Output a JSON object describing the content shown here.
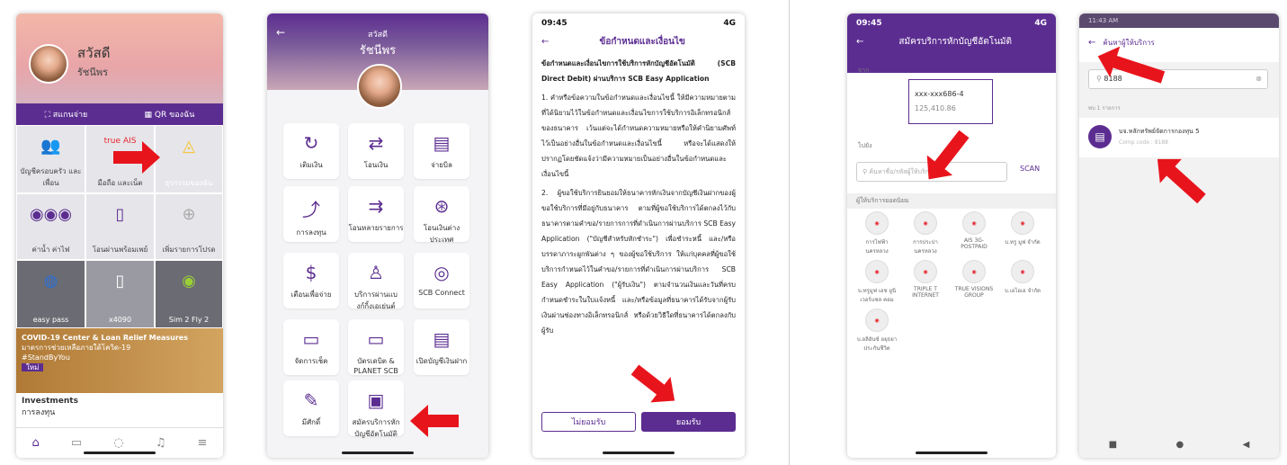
{
  "screen1": {
    "greeting": "สวัสดี",
    "name": "รัชนีพร",
    "scan": "สแกนจ่าย",
    "qr": "QR ของฉัน",
    "tiles": [
      "บัญชีครอบครัว และเพื่อน",
      "มือถือ และเน็ต",
      "ธุรกรรมของฉัน",
      "ค่าน้ำ ค่าไฟ",
      "โอนผ่านพร้อมเพย์",
      "เพิ่มรายการโปรด",
      "easy pass",
      "x4090",
      "Sim 2 Fly 2"
    ],
    "banner_title": "COVID-19 Center & Loan Relief Measures",
    "banner_sub": "มาตรการช่วยเหลือภายใต้โควิด-19",
    "banner_tag": "#StandByYou",
    "banner_badge": "ใหม่",
    "inv_title": "Investments",
    "inv_sub": "การลงทุน"
  },
  "screen2": {
    "greeting": "สวัสดี",
    "name": "รัชนีพร",
    "items": [
      "เติมเงิน",
      "โอนเงิน",
      "จ่ายบิล",
      "การลงทุน",
      "โอนหลายรายการ",
      "โอนเงินต่างประเทศ",
      "เตือนเพื่อจ่าย",
      "บริการผ่านแบงก์กิ้งเอเย่นต์",
      "SCB Connect",
      "จัดการเช็ค",
      "บัตรเดบิต & PLANET SCB",
      "เปิดบัญชีเงินฝาก",
      "มีศักดิ์",
      "สมัครบริการหักบัญชีอัตโนมัติ"
    ]
  },
  "screen3": {
    "time": "09:45",
    "signal": "4G",
    "title": "ข้อกำหนดและเงื่อนไข",
    "heading": "ข้อกำหนดและเงื่อนไขการใช้บริการหักบัญชีอัตโนมัติ (SCB Direct Debit) ผ่านบริการ SCB Easy Application",
    "p1": "1. คำหรือข้อความในข้อกำหนดและเงื่อนไขนี้ ให้มีความหมายตามที่ได้นิยามไว้ในข้อกำหนดและเงื่อนไขการใช้บริการอิเล็กทรอนิกส์ของธนาคาร เว้นแต่จะได้กำหนดความหมายหรือให้คำนิยามศัพท์ไว้เป็นอย่างอื่นในข้อกำหนดและเงื่อนไขนี้ หรือจะได้แสดงให้ปรากฏโดยชัดแจ้งว่ามีความหมายเป็นอย่างอื่นในข้อกำหนดและเงื่อนไขนี้",
    "p2": "2. ผู้ขอใช้บริการยินยอมให้ธนาคารหักเงินจากบัญชีเงินฝากของผู้ขอใช้บริการที่มีอยู่กับธนาคาร ตามที่ผู้ขอใช้บริการได้ตกลงไว้กับธนาคารตามคำขอ/รายการการที่ดำเนินการผ่านบริการ SCB Easy Application (\"บัญชีสำหรับหักชำระ\") เพื่อชำระหนี้ และ/หรือ บรรดาภาระผูกพันต่าง ๆ ของผู้ขอใช้บริการ ให้แก่บุคคลที่ผู้ขอใช้บริการกำหนดไว้ในคำขอ/รายการที่ดำเนินการผ่านบริการ SCB Easy Application (\"ผู้รับเงิน\") ตามจำนวนเงินและวันที่ครบกำหนดชำระในใบแจ้งหนี้ และ/หรือข้อมูลที่ธนาคารได้รับจากผู้รับเงินผ่านช่องทางอิเล็กทรอนิกส์ หรือด้วยวิธีใดที่ธนาคารได้ตกลงกับผู้รับ",
    "decline": "ไม่ยอมรับ",
    "accept": "ยอมรับ"
  },
  "screen4": {
    "time": "09:45",
    "signal": "4G",
    "title": "สมัครบริการหักบัญชีอัตโนมัติ",
    "from": "จาก",
    "account": "xxx-xxx686-4",
    "balance": "125,410.86",
    "to": "ไปยัง",
    "search_placeholder": "ค้นหาชื่อ/รหัสผู้ให้บริการ",
    "scan": "SCAN",
    "billers_title": "ผู้ให้บริการยอดนิยม",
    "billers": [
      "การไฟฟ้านครหลวง",
      "การประปานครหลวง",
      "AIS 3G-POSTPAID",
      "บ.ทรู มูฟ จำกัด",
      "บ.ทรูมูฟ เอช ยูนิเวอร์แซล คอม",
      "TRIPLE T INTERNET",
      "TRUE VISIONS GROUP",
      "บ.เอไอเอ จำกัด",
      "บ.อลิอันซ์ อยุธยา ประกันชีวิต"
    ]
  },
  "screen5": {
    "status": "11:43 AM",
    "title": "ค้นหาผู้ให้บริการ",
    "query": "8188",
    "count": "พบ 1 รายการ",
    "result": "บจ.หลักทรัพย์จัดการกองทุน 5",
    "comp": "Comp code : 8188"
  }
}
